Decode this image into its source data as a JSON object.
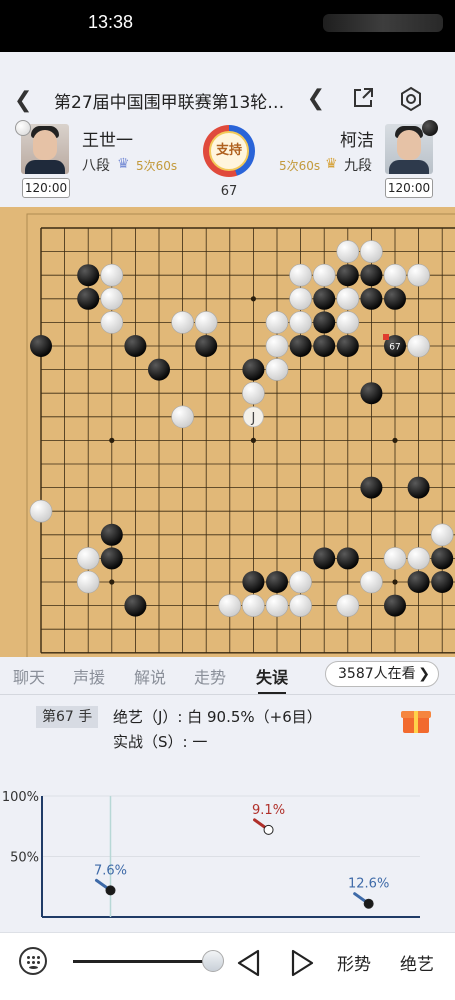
{
  "status_bar": {
    "time": "13:38"
  },
  "header": {
    "title": "第27届中国围甲联赛第13轮…"
  },
  "black_player": {
    "name": "王世一",
    "rank": "八段",
    "byoyomi": "5次60s",
    "clock": "120:00"
  },
  "white_player": {
    "name": "柯洁",
    "rank": "九段",
    "byoyomi": "5次60s",
    "clock": "120:00"
  },
  "support": {
    "label": "支持",
    "black_share": 0.45
  },
  "move_number": "67",
  "board": {
    "size": 19,
    "black": [
      [
        2,
        2
      ],
      [
        2,
        3
      ],
      [
        0,
        5
      ],
      [
        4,
        5
      ],
      [
        6,
        4
      ],
      [
        5,
        6
      ],
      [
        7,
        5
      ],
      [
        9,
        6
      ],
      [
        10,
        6
      ],
      [
        9,
        7
      ],
      [
        10,
        4
      ],
      [
        11,
        3
      ],
      [
        12,
        3
      ],
      [
        12,
        4
      ],
      [
        11,
        5
      ],
      [
        12,
        5
      ],
      [
        13,
        2
      ],
      [
        14,
        2
      ],
      [
        13,
        3
      ],
      [
        14,
        3
      ],
      [
        15,
        3
      ],
      [
        13,
        5
      ],
      [
        14,
        7
      ],
      [
        14,
        11
      ],
      [
        16,
        11
      ],
      [
        3,
        13
      ],
      [
        3,
        14
      ],
      [
        12,
        14
      ],
      [
        13,
        14
      ],
      [
        16,
        15
      ],
      [
        17,
        14
      ],
      [
        17,
        15
      ],
      [
        4,
        16
      ],
      [
        9,
        15
      ],
      [
        10,
        15
      ],
      [
        11,
        15
      ],
      [
        15,
        16
      ]
    ],
    "white": [
      [
        3,
        2
      ],
      [
        3,
        3
      ],
      [
        3,
        4
      ],
      [
        6,
        4
      ],
      [
        7,
        4
      ],
      [
        11,
        2
      ],
      [
        12,
        2
      ],
      [
        13,
        1
      ],
      [
        14,
        1
      ],
      [
        11,
        3
      ],
      [
        13,
        3
      ],
      [
        15,
        2
      ],
      [
        16,
        2
      ],
      [
        10,
        4
      ],
      [
        10,
        5
      ],
      [
        11,
        4
      ],
      [
        13,
        4
      ],
      [
        10,
        6
      ],
      [
        9,
        7
      ],
      [
        6,
        8
      ],
      [
        0,
        12
      ],
      [
        2,
        14
      ],
      [
        2,
        15
      ],
      [
        11,
        15
      ],
      [
        14,
        15
      ],
      [
        15,
        14
      ],
      [
        16,
        14
      ],
      [
        17,
        13
      ],
      [
        8,
        16
      ],
      [
        9,
        16
      ],
      [
        10,
        16
      ],
      [
        11,
        16
      ],
      [
        13,
        16
      ],
      [
        16,
        5
      ]
    ],
    "last_move": {
      "col": 15,
      "row": 5,
      "label": "67"
    },
    "ai_suggestion": {
      "col": 9,
      "row": 8,
      "label": "J"
    }
  },
  "tabs": [
    "聊天",
    "声援",
    "解说",
    "走势",
    "失误"
  ],
  "active_tab": "失误",
  "viewers": "3587人在看",
  "analysis": {
    "move_label": "第67 手",
    "ai_line": "绝艺（J）: 白 90.5%（+6目）",
    "real_line": "实战（S）: 一"
  },
  "mistake_chart": {
    "y_ticks": [
      "100%",
      "50%"
    ],
    "points": [
      {
        "move": 13,
        "loss_label": "7.6%",
        "color": "#1a1a1a",
        "label_color": "#3e6aa8",
        "side": "black",
        "y_pct": 22
      },
      {
        "move": 43,
        "loss_label": "9.1%",
        "color": "#ffffff",
        "label_color": "#b0302a",
        "side": "white",
        "y_pct": 72
      },
      {
        "move": 62,
        "loss_label": "12.6%",
        "color": "#1a1a1a",
        "label_color": "#3e6aa8",
        "side": "black",
        "y_pct": 11
      }
    ],
    "current_move_marker": 13
  },
  "bottom": {
    "shape_label": "形势",
    "ai_label": "绝艺"
  },
  "colors": {
    "board": "#e1b878",
    "accent_red": "#e03b2e",
    "accent_blue": "#2a64d8"
  }
}
